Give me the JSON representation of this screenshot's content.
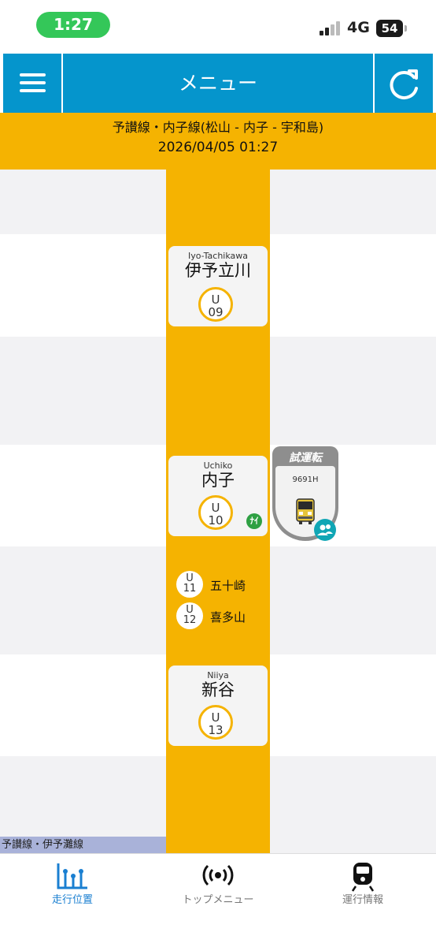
{
  "status_bar": {
    "time": "1:27",
    "network": "4G",
    "battery": "54"
  },
  "header": {
    "title": "メニュー",
    "menu_icon": "hamburger-menu-icon",
    "reload_icon": "reload-icon"
  },
  "route": {
    "name": "予讃線・内子線(松山 - 内子 - 宇和島)",
    "datetime": "2026/04/05 01:27"
  },
  "stations": [
    {
      "en": "Iyo-Tachikawa",
      "jp": "伊予立川",
      "line_letter": "U",
      "number": "09"
    },
    {
      "en": "Uchiko",
      "jp": "内子",
      "line_letter": "U",
      "number": "10",
      "transfer_icon": "transfer-icon",
      "transfer_text": "ﾅｲ"
    },
    {
      "en": "Niiya",
      "jp": "新谷",
      "line_letter": "U",
      "number": "13"
    }
  ],
  "minor_stops": [
    {
      "line_letter": "U",
      "number": "11",
      "name": "五十崎"
    },
    {
      "line_letter": "U",
      "number": "12",
      "name": "喜多山"
    }
  ],
  "train": {
    "label": "試運転",
    "number": "9691H",
    "icon": "train-front-icon",
    "badge_icon": "people-icon"
  },
  "line_label": "予讃線・伊予灘線",
  "tabs": [
    {
      "label": "走行位置",
      "icon": "position-chart-icon",
      "active": true
    },
    {
      "label": "トップメニュー",
      "icon": "broadcast-icon",
      "active": false
    },
    {
      "label": "運行情報",
      "icon": "train-icon",
      "active": false
    }
  ],
  "colors": {
    "header": "#0595cc",
    "route": "#f5b301",
    "active_tab": "#1a7fd1",
    "inactive_tab": "#777777",
    "status_pill": "#34c759"
  }
}
